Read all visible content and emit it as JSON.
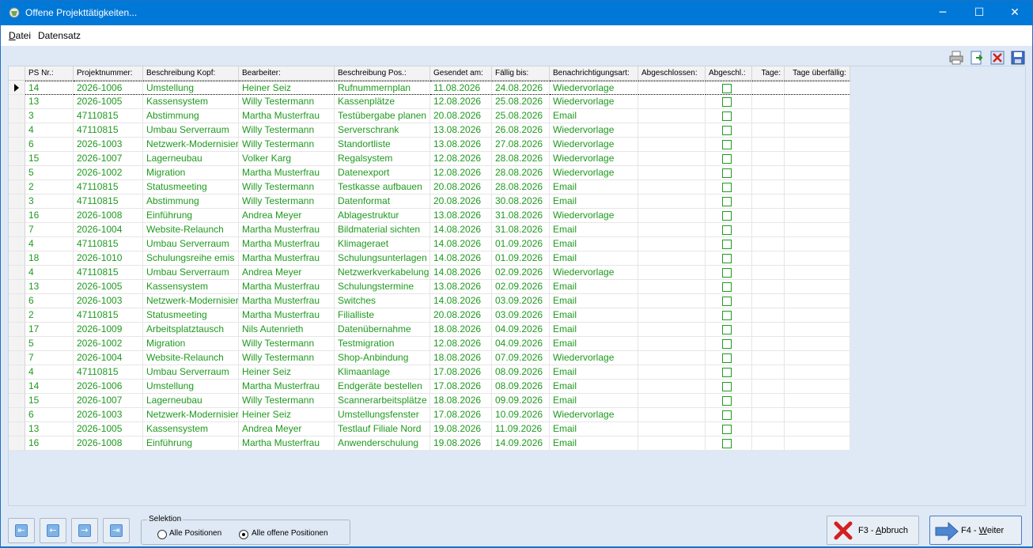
{
  "window": {
    "title": "Offene Projekttätigkeiten..."
  },
  "menu": {
    "items": [
      {
        "label": "Datei",
        "first": "D",
        "rest": "atei"
      },
      {
        "label": "Datensatz"
      }
    ]
  },
  "toolbar": {
    "icons": [
      "print-icon",
      "export-icon",
      "delete-icon",
      "save-icon"
    ]
  },
  "table": {
    "columns": [
      "PS Nr.:",
      "Projektnummer:",
      "Beschreibung Kopf:",
      "Bearbeiter:",
      "Beschreibung Pos.:",
      "Gesendet am:",
      "Fällig bis:",
      "Benachrichtigungsart:",
      "Abgeschlossen:",
      "Abgeschl.:",
      "Tage:",
      "Tage überfällig:"
    ],
    "rows": [
      [
        "14",
        "2026-1006",
        "Umstellung",
        "Heiner Seiz",
        "Rufnummernplan",
        "11.08.2026",
        "24.08.2026",
        "Wiedervorlage"
      ],
      [
        "13",
        "2026-1005",
        "Kassensystem",
        "Willy Testermann",
        "Kassenplätze",
        "12.08.2026",
        "25.08.2026",
        "Wiedervorlage"
      ],
      [
        "3",
        "47110815",
        "Abstimmung",
        "Martha Musterfrau",
        "Testübergabe planen",
        "20.08.2026",
        "25.08.2026",
        "Email"
      ],
      [
        "4",
        "47110815",
        "Umbau Serverraum",
        "Willy Testermann",
        "Serverschrank",
        "13.08.2026",
        "26.08.2026",
        "Wiedervorlage"
      ],
      [
        "6",
        "2026-1003",
        "Netzwerk-Modernisierung",
        "Willy Testermann",
        "Standortliste",
        "13.08.2026",
        "27.08.2026",
        "Wiedervorlage"
      ],
      [
        "15",
        "2026-1007",
        "Lagerneubau",
        "Volker Karg",
        "Regalsystem",
        "12.08.2026",
        "28.08.2026",
        "Wiedervorlage"
      ],
      [
        "5",
        "2026-1002",
        "Migration",
        "Martha Musterfrau",
        "Datenexport",
        "12.08.2026",
        "28.08.2026",
        "Wiedervorlage"
      ],
      [
        "2",
        "47110815",
        "Statusmeeting",
        "Willy Testermann",
        "Testkasse aufbauen",
        "20.08.2026",
        "28.08.2026",
        "Email"
      ],
      [
        "3",
        "47110815",
        "Abstimmung",
        "Willy Testermann",
        "Datenformat",
        "20.08.2026",
        "30.08.2026",
        "Email"
      ],
      [
        "16",
        "2026-1008",
        "Einführung",
        "Andrea Meyer",
        "Ablagestruktur",
        "13.08.2026",
        "31.08.2026",
        "Wiedervorlage"
      ],
      [
        "7",
        "2026-1004",
        "Website-Relaunch",
        "Martha Musterfrau",
        "Bildmaterial sichten",
        "14.08.2026",
        "31.08.2026",
        "Email"
      ],
      [
        "4",
        "47110815",
        "Umbau Serverraum",
        "Martha Musterfrau",
        "Klimageraet",
        "14.08.2026",
        "01.09.2026",
        "Email"
      ],
      [
        "18",
        "2026-1010",
        "Schulungsreihe emis",
        "Martha Musterfrau",
        "Schulungsunterlagen",
        "14.08.2026",
        "01.09.2026",
        "Email"
      ],
      [
        "4",
        "47110815",
        "Umbau Serverraum",
        "Andrea Meyer",
        "Netzwerkverkabelung",
        "14.08.2026",
        "02.09.2026",
        "Wiedervorlage"
      ],
      [
        "13",
        "2026-1005",
        "Kassensystem",
        "Martha Musterfrau",
        "Schulungstermine",
        "13.08.2026",
        "02.09.2026",
        "Email"
      ],
      [
        "6",
        "2026-1003",
        "Netzwerk-Modernisierung",
        "Martha Musterfrau",
        "Switches",
        "14.08.2026",
        "03.09.2026",
        "Email"
      ],
      [
        "2",
        "47110815",
        "Statusmeeting",
        "Martha Musterfrau",
        "Filialliste",
        "20.08.2026",
        "03.09.2026",
        "Email"
      ],
      [
        "17",
        "2026-1009",
        "Arbeitsplatztausch",
        "Nils Autenrieth",
        "Datenübernahme",
        "18.08.2026",
        "04.09.2026",
        "Email"
      ],
      [
        "5",
        "2026-1002",
        "Migration",
        "Willy Testermann",
        "Testmigration",
        "12.08.2026",
        "04.09.2026",
        "Email"
      ],
      [
        "7",
        "2026-1004",
        "Website-Relaunch",
        "Willy Testermann",
        "Shop-Anbindung",
        "18.08.2026",
        "07.09.2026",
        "Wiedervorlage"
      ],
      [
        "4",
        "47110815",
        "Umbau Serverraum",
        "Heiner Seiz",
        "Klimaanlage",
        "17.08.2026",
        "08.09.2026",
        "Email"
      ],
      [
        "14",
        "2026-1006",
        "Umstellung",
        "Martha Musterfrau",
        "Endgeräte bestellen",
        "17.08.2026",
        "08.09.2026",
        "Email"
      ],
      [
        "15",
        "2026-1007",
        "Lagerneubau",
        "Willy Testermann",
        "Scannerarbeitsplätze",
        "18.08.2026",
        "09.09.2026",
        "Email"
      ],
      [
        "6",
        "2026-1003",
        "Netzwerk-Modernisierung",
        "Heiner Seiz",
        "Umstellungsfenster",
        "17.08.2026",
        "10.09.2026",
        "Wiedervorlage"
      ],
      [
        "13",
        "2026-1005",
        "Kassensystem",
        "Andrea Meyer",
        "Testlauf Filiale Nord",
        "19.08.2026",
        "11.09.2026",
        "Email"
      ],
      [
        "16",
        "2026-1008",
        "Einführung",
        "Martha Musterfrau",
        "Anwenderschulung",
        "19.08.2026",
        "14.09.2026",
        "Email"
      ]
    ]
  },
  "selection": {
    "legend": "Selektion",
    "options": [
      {
        "label": "Alle Positionen",
        "selected": false
      },
      {
        "label": "Alle offene Positionen",
        "selected": true
      }
    ]
  },
  "buttons": {
    "cancel": {
      "pre": "F3 - ",
      "u": "A",
      "post": "bbruch"
    },
    "next": {
      "pre": "F4 - ",
      "u": "W",
      "post": "eiter"
    }
  },
  "colors": {
    "title_bar": "#0078d7",
    "row_text": "#1f9a1f",
    "background": "#dfe9f5"
  }
}
